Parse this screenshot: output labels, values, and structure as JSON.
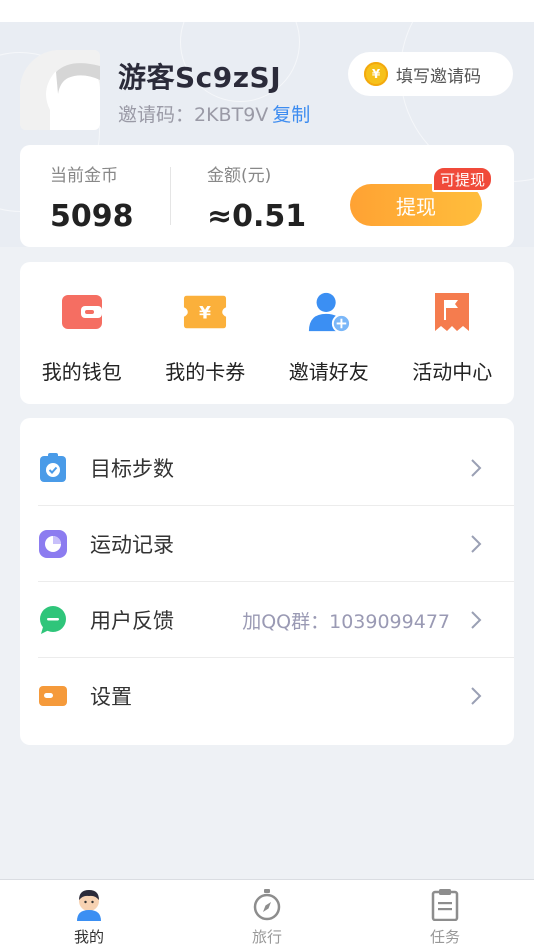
{
  "profile": {
    "username": "游客Sc9zSJ",
    "invite_label": "邀请码：2KBT9V",
    "copy_label": "复制",
    "fill_invite_label": "填写邀请码",
    "coin_symbol": "¥"
  },
  "balance": {
    "coins_label": "当前金币",
    "coins_value": "5098",
    "amount_label": "金额(元)",
    "amount_value": "≈0.51",
    "withdraw_label": "提现",
    "withdraw_badge": "可提现"
  },
  "quick_actions": [
    {
      "label": "我的钱包",
      "icon": "wallet-icon",
      "color": "#f56e62"
    },
    {
      "label": "我的卡券",
      "icon": "coupon-icon",
      "color": "#fbb03b"
    },
    {
      "label": "邀请好友",
      "icon": "invite-friend-icon",
      "color": "#3b8ff3"
    },
    {
      "label": "活动中心",
      "icon": "activity-flag-icon",
      "color": "#f57c4e"
    }
  ],
  "menu": [
    {
      "label": "目标步数",
      "extra": "",
      "icon": "target-steps-icon",
      "color": "#4a9be8"
    },
    {
      "label": "运动记录",
      "extra": "",
      "icon": "exercise-record-icon",
      "color": "#8c7cf0"
    },
    {
      "label": "用户反馈",
      "extra": "加QQ群：1039099477",
      "icon": "feedback-icon",
      "color": "#2fc57a"
    },
    {
      "label": "设置",
      "extra": "",
      "icon": "settings-toggle-icon",
      "color": "#f59a3b"
    }
  ],
  "tabs": [
    {
      "label": "我的",
      "icon": "profile-avatar-icon",
      "active": true
    },
    {
      "label": "旅行",
      "icon": "compass-icon",
      "active": false
    },
    {
      "label": "任务",
      "icon": "task-list-icon",
      "active": false
    }
  ]
}
